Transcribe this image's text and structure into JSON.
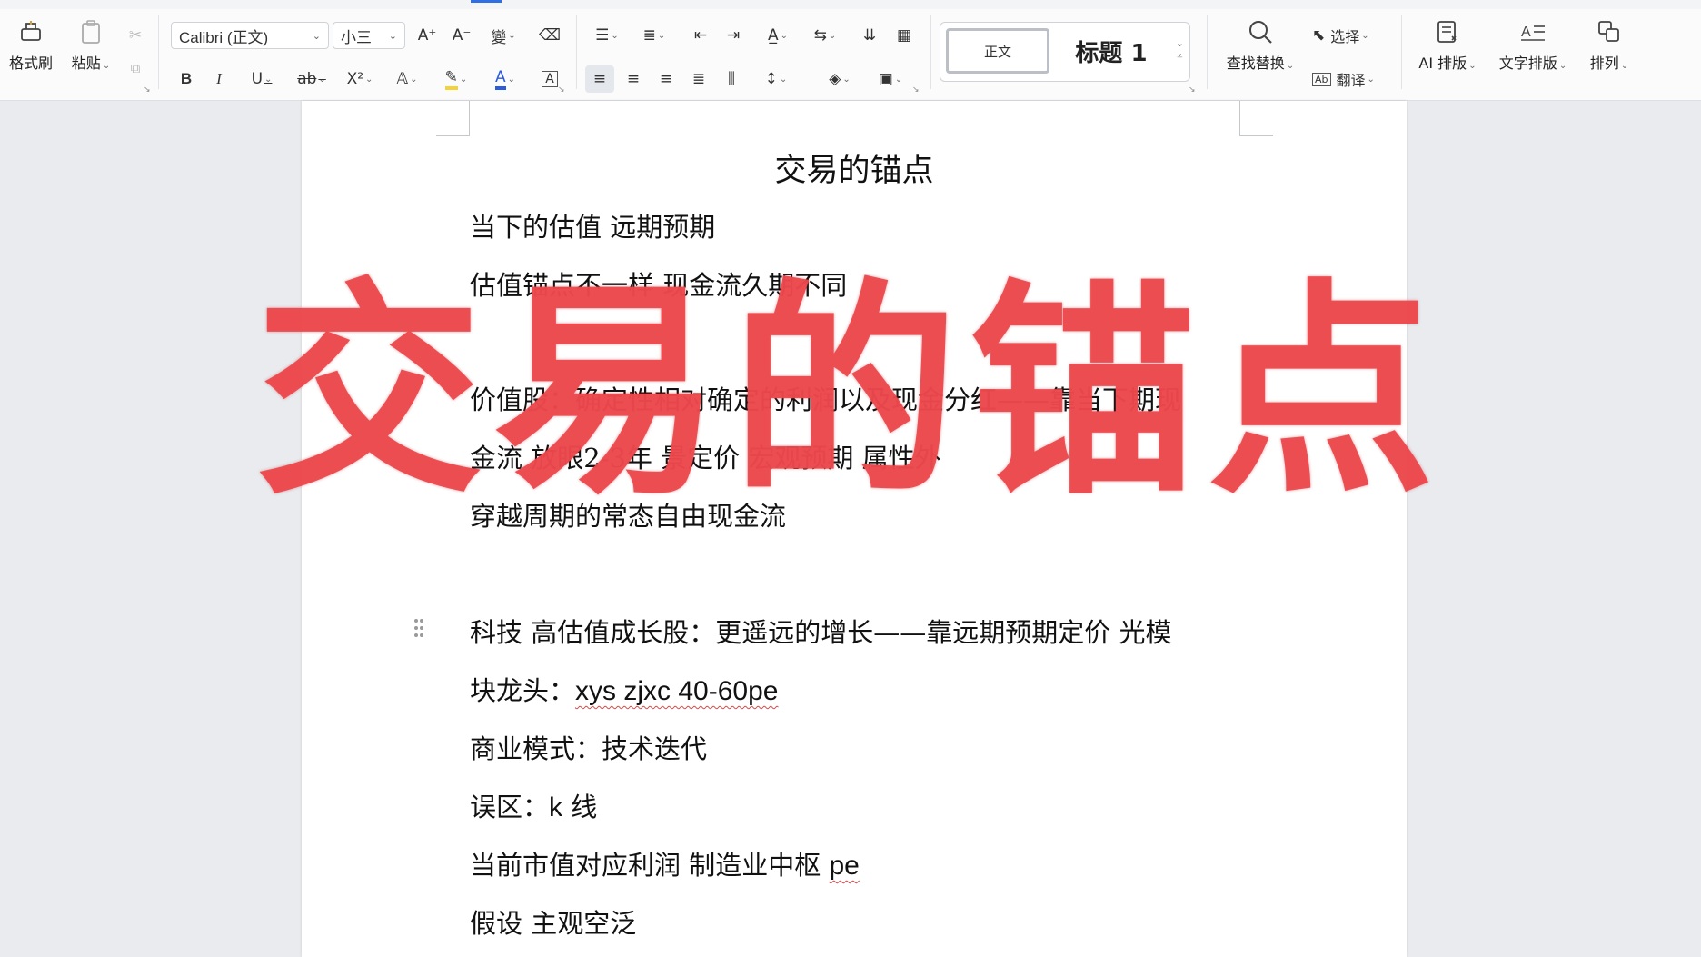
{
  "toolbar": {
    "clipboard": {
      "format_painter": "格式刷",
      "paste": "粘贴"
    },
    "font": {
      "family": "Calibri (正文)",
      "size": "小三"
    },
    "styles": {
      "normal": "正文",
      "heading1": "标题 1"
    },
    "find_replace": "查找替换",
    "select": "选择",
    "translate": "翻译",
    "ai_layout": "AI 排版",
    "text_layout": "文字排版",
    "arrange": "排列",
    "format_buttons": {
      "bold": "B",
      "italic": "I",
      "underline": "U",
      "strike": "ab",
      "superscript": "X²",
      "grow_font": "A⁺",
      "shrink_font": "A⁻"
    }
  },
  "document": {
    "title": "交易的锚点",
    "lines": [
      {
        "text": "当下的估值  远期预期"
      },
      {
        "text": "估值锚点不一样  现金流久期不同"
      },
      {
        "text": "价值股：确定性相对确定的利润以及现金分红——靠当下期现"
      },
      {
        "text": "金流  放眼2-3年  景定价  宏观预期  属性外"
      },
      {
        "text": "穿越周期的常态自由现金流"
      },
      {
        "text": "科技  高估值成长股：更遥远的增长——靠远期预期定价    光模"
      },
      {
        "pre": "块龙头：",
        "latin": "xys zjxc 40-60pe"
      },
      {
        "text": "商业模式：技术迭代"
      },
      {
        "pre": "误区：",
        "latin": "k",
        "post": " 线"
      },
      {
        "pre": "当前市值对应利润  制造业中枢 ",
        "latin": "pe"
      },
      {
        "text": "假设  主观空泛"
      }
    ]
  },
  "overlay_title": "交易的锚点",
  "colors": {
    "overlay": "#ec494d",
    "accent": "#2f6fe4",
    "page": "#ffffff",
    "canvas": "#e9ebee"
  }
}
